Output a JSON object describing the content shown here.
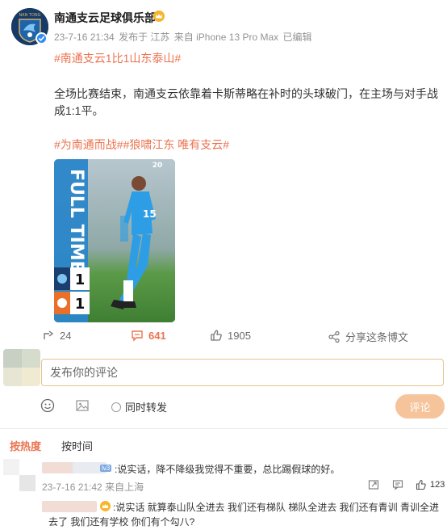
{
  "post": {
    "author": "南通支云足球俱乐部",
    "time": "23-7-16 21:34",
    "location": "发布于 江苏",
    "device": "来自 iPhone 13 Pro Max",
    "edited": "已编辑",
    "topic_main": "#南通支云1比1山东泰山#",
    "body": "全场比赛结束，南通支云依靠着卡斯蒂略在补时的头球破门，在主场与对手战成1:1平。",
    "topics_extra": "#为南通而战##狼啸江东 唯有支云#",
    "image": {
      "banner": "FULL TIME",
      "score_home": "1",
      "score_away": "1",
      "corner_tag": "20",
      "jersey_number": "15"
    }
  },
  "actions": {
    "share_count": "24",
    "comment_count": "641",
    "like_count": "1905",
    "share_label": "分享这条博文"
  },
  "composer": {
    "placeholder": "发布你的评论",
    "repost_label": "同时转发",
    "submit_label": "评论"
  },
  "sort": {
    "hot": "按热度",
    "time": "按时间"
  },
  "comments": [
    {
      "badge": "lv3",
      "text": ":说实话，降不降级我觉得不重要，总比踢假球的好。",
      "time": "23-7-16 21:42",
      "location": "来自上海",
      "likes": "123",
      "reply_text": ":说实话 就算泰山队全进去 我们还有梯队 梯队全进去 我们还有青训 青训全进去了 我们还有学校 你们有个勾八?"
    }
  ],
  "colors": {
    "accent": "#eb7350",
    "verify": "#2e8cf0",
    "jersey": "#2d9de6",
    "submit_disabled": "#f5c49a"
  }
}
